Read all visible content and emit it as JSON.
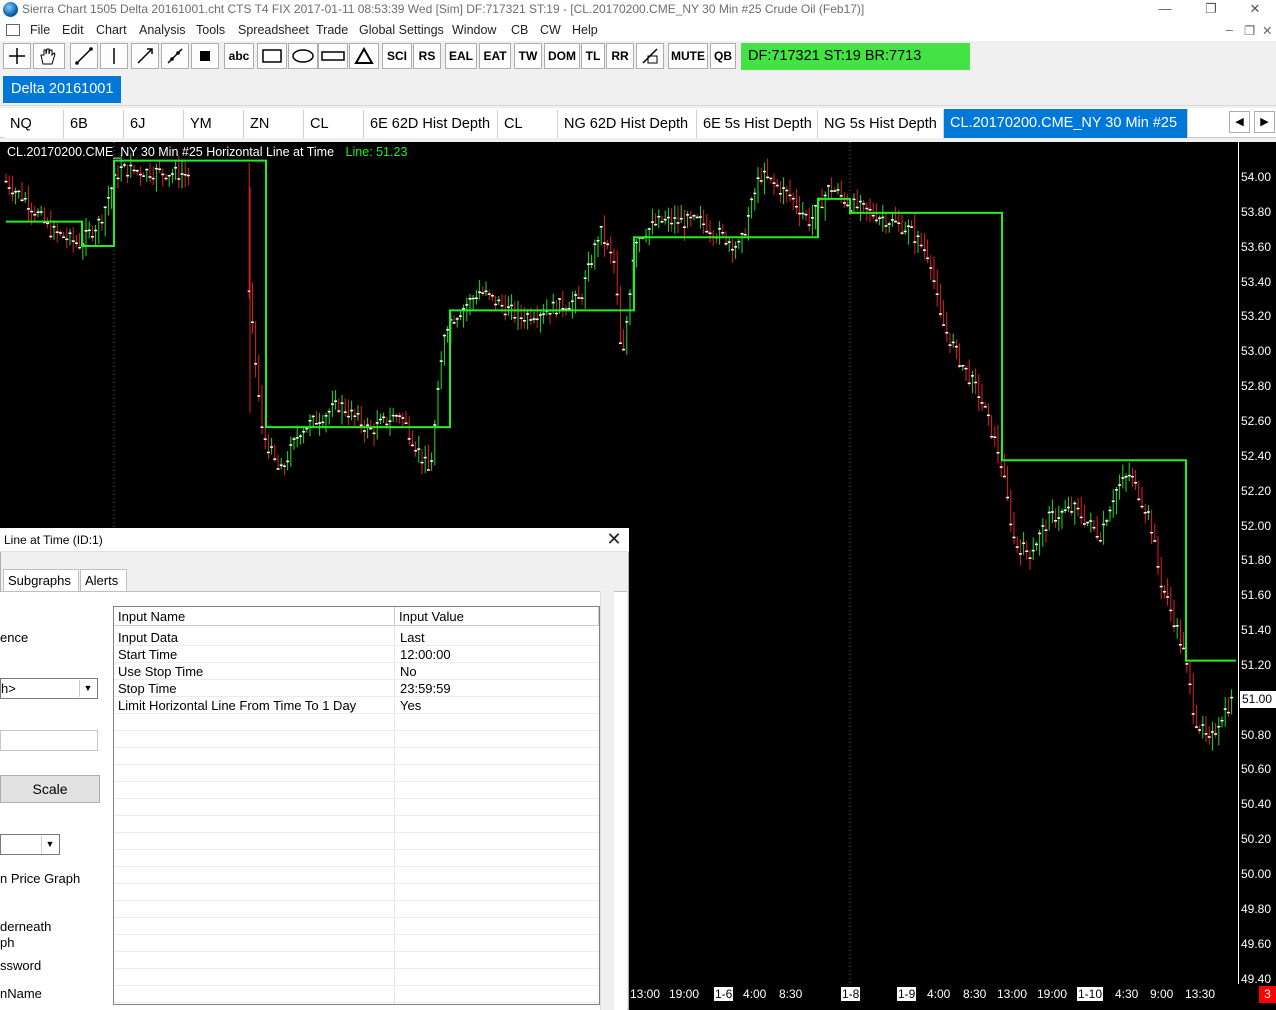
{
  "window": {
    "title": "Sierra Chart 1505 Delta 20161001.cht  CTS T4 FIX 2017-01-11  08:53:39 Wed [Sim]  DF:717321  ST:19 - [CL.20170200.CME_NY  30 Min  #25  Crude Oil (Feb17)]",
    "minimize": "—",
    "maximize": "❐",
    "close": "✕"
  },
  "menu": [
    "File",
    "Edit",
    "Chart",
    "Analysis",
    "Tools",
    "Spreadsheet",
    "Trade",
    "Global Settings",
    "Window",
    "CB",
    "CW",
    "Help"
  ],
  "mdi_controls": [
    "‒",
    "❐",
    "✕"
  ],
  "toolbar": {
    "text_buttons": [
      "abc",
      "SCI",
      "RS",
      "EAL",
      "EAT",
      "TW",
      "DOM",
      "TL",
      "RR",
      "MUTE",
      "QB"
    ],
    "status": "DF:717321  ST:19  BR:7713",
    "status_color": "#44e344"
  },
  "chartbook_tab": "Delta 20161001",
  "chart_tabs": [
    "NQ",
    "6B",
    "6J",
    "YM",
    "ZN",
    "CL",
    "6E 62D Hist Depth",
    "CL",
    "NG 62D Hist Depth",
    "6E 5s Hist Depth",
    "NG 5s Hist Depth",
    "CL.20170200.CME_NY  30 Min   #25"
  ],
  "active_tab_index": 11,
  "chart_header": {
    "text": "CL.20170200.CME_NY  30 Min   #25  Horizontal Line at Time",
    "line_label": "Line: 51.23"
  },
  "chart_data": {
    "type": "ohlc-bar",
    "instrument": "CL.20170200.CME_NY",
    "interval": "30 Min",
    "ylim": [
      49.4,
      54.1
    ],
    "price_ticks": [
      "54.00",
      "53.80",
      "53.60",
      "53.40",
      "53.20",
      "53.00",
      "52.80",
      "52.60",
      "52.40",
      "52.20",
      "52.00",
      "51.80",
      "51.60",
      "51.40",
      "51.20",
      "51.00",
      "50.80",
      "50.60",
      "50.40",
      "50.20",
      "50.00",
      "49.80",
      "49.60",
      "49.40"
    ],
    "last_price": "51.00",
    "time_ticks": [
      {
        "label": "13:00",
        "boxed": false
      },
      {
        "label": "19:00",
        "boxed": false
      },
      {
        "label": "1-6",
        "boxed": true
      },
      {
        "label": "4:00",
        "boxed": false
      },
      {
        "label": "8:30",
        "boxed": false
      },
      {
        "label": "1-8",
        "boxed": true
      },
      {
        "label": "1-9",
        "boxed": true
      },
      {
        "label": "4:00",
        "boxed": false
      },
      {
        "label": "8:30",
        "boxed": false
      },
      {
        "label": "13:00",
        "boxed": false
      },
      {
        "label": "19:00",
        "boxed": false
      },
      {
        "label": "1-10",
        "boxed": true
      },
      {
        "label": "4:30",
        "boxed": false
      },
      {
        "label": "9:00",
        "boxed": false
      },
      {
        "label": "13:30",
        "boxed": false
      }
    ],
    "horizontal_line_levels": [
      53.75,
      53.61,
      54.1,
      52.57,
      53.24,
      53.66,
      53.88,
      53.8,
      52.38,
      51.23
    ],
    "corner_indicator": "3",
    "series_colors": {
      "up": "#22dd22",
      "down": "#dd2222",
      "line": "#22ee22"
    }
  },
  "dialog": {
    "title": "Line at Time (ID:1)",
    "close": "✕",
    "tabs": [
      "Subgraphs",
      "Alerts"
    ],
    "left_labels": [
      "ence",
      "h>",
      "n Price Graph",
      "derneath",
      "ph",
      "ssword",
      "nName"
    ],
    "scale_button": "Scale",
    "grid_headers": [
      "Input Name",
      "Input Value"
    ],
    "inputs": [
      {
        "name": "Input Data",
        "value": "Last"
      },
      {
        "name": "Start Time",
        "value": "12:00:00"
      },
      {
        "name": "Use Stop Time",
        "value": "No"
      },
      {
        "name": "Stop Time",
        "value": "23:59:59"
      },
      {
        "name": "Limit Horizontal Line From Time To 1 Day",
        "value": "Yes"
      }
    ]
  }
}
